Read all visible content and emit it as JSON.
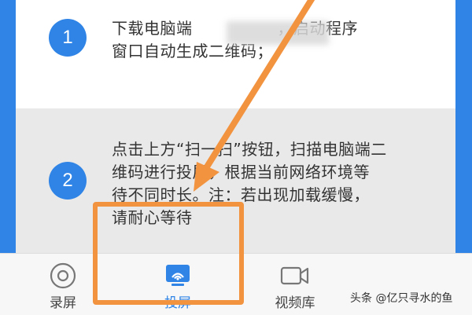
{
  "steps": [
    {
      "number": "1",
      "lines": [
        "下载电脑端",
        "窗口自动生成二维码；"
      ],
      "line1_tail": "，启动程序"
    },
    {
      "number": "2",
      "lines": [
        "点击上方“扫一扫”按钮，扫描电脑端二",
        "维码进行投屏，根据当前网络环境等",
        "待不同时长。注：若出现加载缓慢，",
        "请耐心等待"
      ]
    }
  ],
  "tab_bar": {
    "tabs": [
      {
        "label": "录屏",
        "icon": "record-circle-icon"
      },
      {
        "label": "投屏",
        "icon": "screen-cast-icon",
        "active": true
      },
      {
        "label": "视频库",
        "icon": "video-camera-icon"
      }
    ]
  },
  "watermark": "头条 @亿只寻水的鱼",
  "colors": {
    "accent": "#2f84e6",
    "annotation": "#f29340",
    "step2_bg": "#e9e9e9"
  }
}
